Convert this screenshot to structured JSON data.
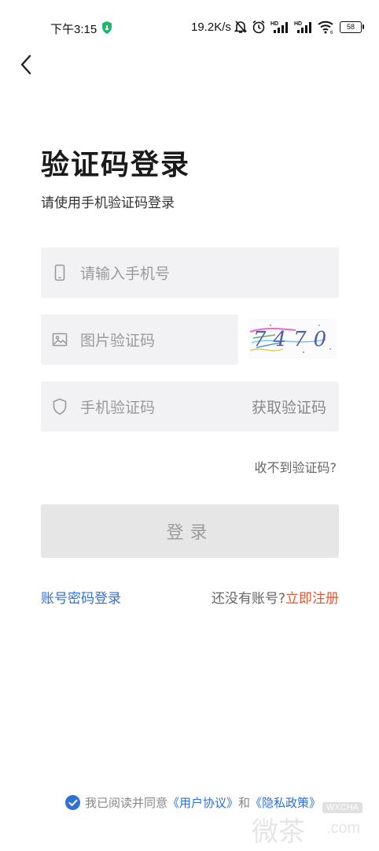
{
  "status_bar": {
    "time": "下午3:15",
    "net_speed": "19.2K/s",
    "battery": "58",
    "icons": [
      "shield-icon",
      "mute-bell-icon",
      "alarm-icon",
      "hd-signal-icon",
      "hd-signal-icon",
      "wifi-icon",
      "battery-icon"
    ]
  },
  "header": {
    "back_icon": "chevron-left-icon",
    "title": "验证码登录",
    "subtitle": "请使用手机验证码登录"
  },
  "form": {
    "phone_placeholder": "请输入手机号",
    "image_code_placeholder": "图片验证码",
    "captcha_text": "7470",
    "sms_code_placeholder": "手机验证码",
    "get_code_label": "获取验证码",
    "no_code_link": "收不到验证码?",
    "login_button": "登录"
  },
  "footer_links": {
    "password_login": "账号密码登录",
    "no_account": "还没有账号?",
    "register": "立即注册"
  },
  "agreement": {
    "prefix": "我已阅读并同意",
    "user_agreement": "《用户协议》",
    "and": "和",
    "privacy_policy": "《隐私政策》"
  },
  "watermark": {
    "badge": "WXCHA",
    "big": "微茶",
    "suffix": ".com"
  },
  "colors": {
    "accent_blue": "#2f6fd6",
    "register_orange": "#e4572e",
    "field_bg": "#f2f2f4",
    "button_disabled_bg": "#e6e6e6"
  }
}
